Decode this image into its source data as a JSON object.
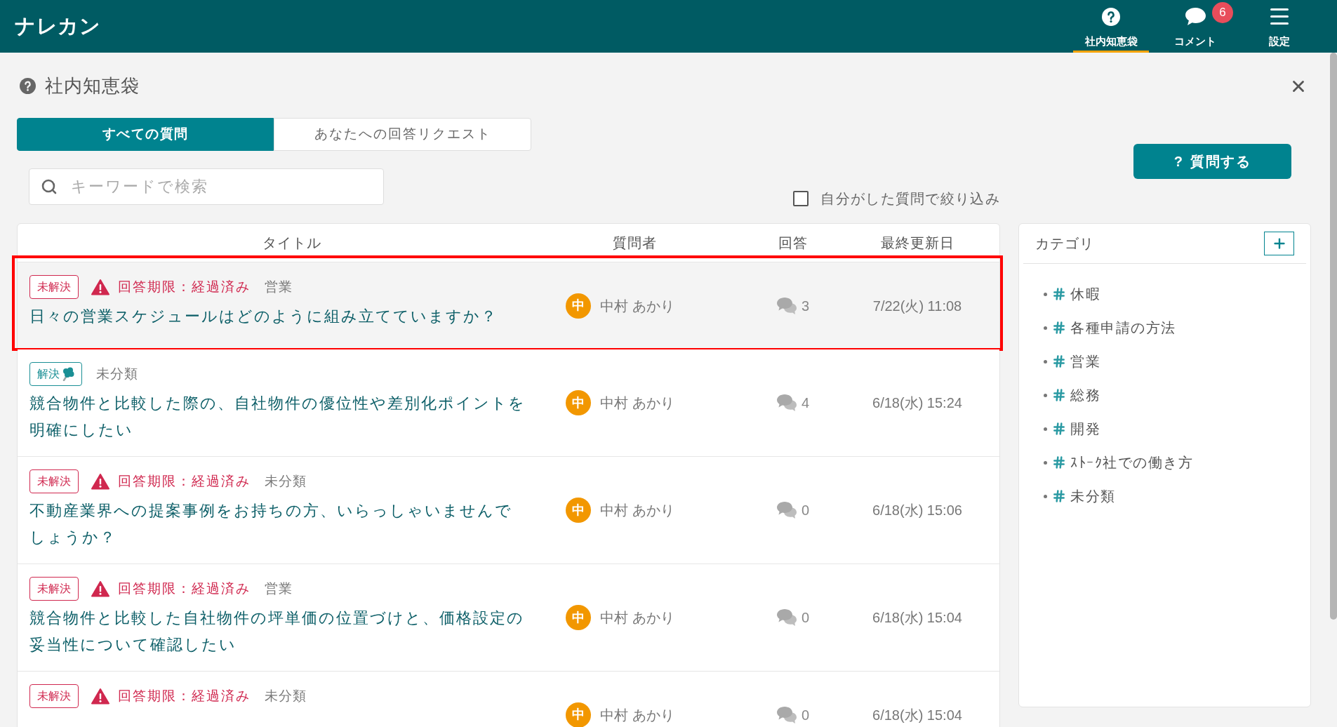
{
  "app": {
    "logo": "ナレカン"
  },
  "nav": [
    {
      "kind": "help",
      "label": "社内知恵袋",
      "selected": true
    },
    {
      "kind": "comment",
      "label": "コメント",
      "selected": false,
      "badge": "6"
    },
    {
      "kind": "menu",
      "label": "設定",
      "selected": false
    }
  ],
  "page": {
    "title": "社内知恵袋"
  },
  "tabs": [
    {
      "label": "すべての質問",
      "selected": true
    },
    {
      "label": "あなたへの回答リクエスト",
      "selected": false
    }
  ],
  "search": {
    "placeholder": "キーワードで検索"
  },
  "ask_button": {
    "icon_text": "?",
    "label": "質問する"
  },
  "filter": {
    "label": "自分がした質問で絞り込み",
    "checked": false
  },
  "table": {
    "columns": [
      "タイトル",
      "質問者",
      "回答",
      "最終更新日"
    ],
    "rows": [
      {
        "status": {
          "label": "未解決",
          "resolved": false
        },
        "meta": [
          {
            "kind": "deadline",
            "text": "回答期限：経過済み"
          },
          {
            "kind": "category",
            "text": "営業"
          }
        ],
        "title": "日々の営業スケジュールはどのように組み立てていますか？",
        "asker": {
          "initial": "中",
          "name": "中村 あかり"
        },
        "answers": "3",
        "updated": "7/22(火) 11:08",
        "selected": true
      },
      {
        "status": {
          "label": "解決",
          "resolved": true
        },
        "meta": [
          {
            "kind": "category",
            "text": "未分類"
          }
        ],
        "title": "競合物件と比較した際の、自社物件の優位性や差別化ポイントを明確にしたい",
        "asker": {
          "initial": "中",
          "name": "中村 あかり"
        },
        "answers": "4",
        "updated": "6/18(水) 15:24",
        "selected": false
      },
      {
        "status": {
          "label": "未解決",
          "resolved": false
        },
        "meta": [
          {
            "kind": "deadline",
            "text": "回答期限：経過済み"
          },
          {
            "kind": "category",
            "text": "未分類"
          }
        ],
        "title": "不動産業界への提案事例をお持ちの方、いらっしゃいませんでしょうか？",
        "asker": {
          "initial": "中",
          "name": "中村 あかり"
        },
        "answers": "0",
        "updated": "6/18(水) 15:06",
        "selected": false
      },
      {
        "status": {
          "label": "未解決",
          "resolved": false
        },
        "meta": [
          {
            "kind": "deadline",
            "text": "回答期限：経過済み"
          },
          {
            "kind": "category",
            "text": "営業"
          }
        ],
        "title": "競合物件と比較した自社物件の坪単価の位置づけと、価格設定の妥当性について確認したい",
        "asker": {
          "initial": "中",
          "name": "中村 あかり"
        },
        "answers": "0",
        "updated": "6/18(水) 15:04",
        "selected": false
      },
      {
        "status": {
          "label": "未解決",
          "resolved": false
        },
        "meta": [
          {
            "kind": "deadline",
            "text": "回答期限：経過済み"
          },
          {
            "kind": "category",
            "text": "未分類"
          }
        ],
        "asker": {
          "initial": "中",
          "name": "中村 あかり"
        },
        "answers": "0",
        "updated": "6/18(水) 15:04",
        "selected": false
      }
    ]
  },
  "categories": {
    "title": "カテゴリ",
    "items": [
      "休暇",
      "各種申請の方法",
      "営業",
      "総務",
      "開発",
      "ｽﾄｰｸ社での働き方",
      "未分類"
    ]
  }
}
